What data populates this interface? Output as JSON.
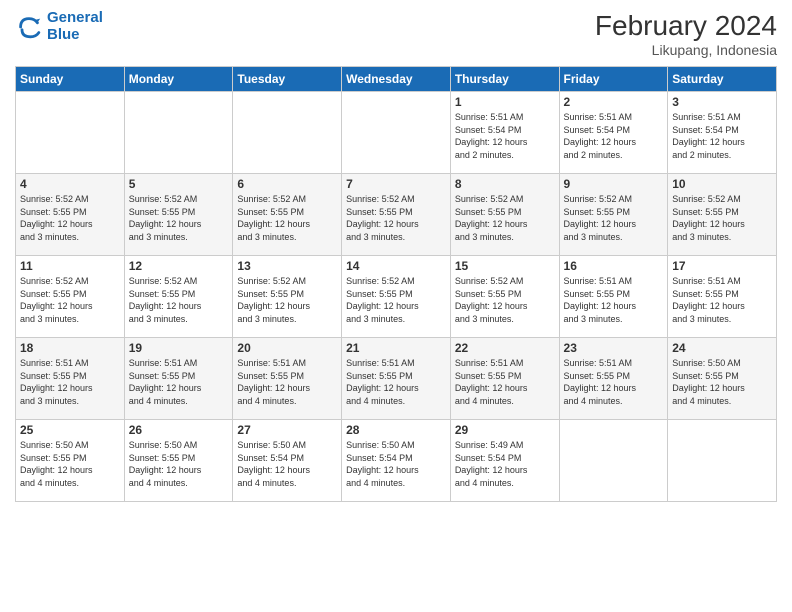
{
  "logo": {
    "line1": "General",
    "line2": "Blue"
  },
  "header": {
    "month": "February 2024",
    "location": "Likupang, Indonesia"
  },
  "weekdays": [
    "Sunday",
    "Monday",
    "Tuesday",
    "Wednesday",
    "Thursday",
    "Friday",
    "Saturday"
  ],
  "weeks": [
    [
      {
        "day": "",
        "info": ""
      },
      {
        "day": "",
        "info": ""
      },
      {
        "day": "",
        "info": ""
      },
      {
        "day": "",
        "info": ""
      },
      {
        "day": "1",
        "info": "Sunrise: 5:51 AM\nSunset: 5:54 PM\nDaylight: 12 hours\nand 2 minutes."
      },
      {
        "day": "2",
        "info": "Sunrise: 5:51 AM\nSunset: 5:54 PM\nDaylight: 12 hours\nand 2 minutes."
      },
      {
        "day": "3",
        "info": "Sunrise: 5:51 AM\nSunset: 5:54 PM\nDaylight: 12 hours\nand 2 minutes."
      }
    ],
    [
      {
        "day": "4",
        "info": "Sunrise: 5:52 AM\nSunset: 5:55 PM\nDaylight: 12 hours\nand 3 minutes."
      },
      {
        "day": "5",
        "info": "Sunrise: 5:52 AM\nSunset: 5:55 PM\nDaylight: 12 hours\nand 3 minutes."
      },
      {
        "day": "6",
        "info": "Sunrise: 5:52 AM\nSunset: 5:55 PM\nDaylight: 12 hours\nand 3 minutes."
      },
      {
        "day": "7",
        "info": "Sunrise: 5:52 AM\nSunset: 5:55 PM\nDaylight: 12 hours\nand 3 minutes."
      },
      {
        "day": "8",
        "info": "Sunrise: 5:52 AM\nSunset: 5:55 PM\nDaylight: 12 hours\nand 3 minutes."
      },
      {
        "day": "9",
        "info": "Sunrise: 5:52 AM\nSunset: 5:55 PM\nDaylight: 12 hours\nand 3 minutes."
      },
      {
        "day": "10",
        "info": "Sunrise: 5:52 AM\nSunset: 5:55 PM\nDaylight: 12 hours\nand 3 minutes."
      }
    ],
    [
      {
        "day": "11",
        "info": "Sunrise: 5:52 AM\nSunset: 5:55 PM\nDaylight: 12 hours\nand 3 minutes."
      },
      {
        "day": "12",
        "info": "Sunrise: 5:52 AM\nSunset: 5:55 PM\nDaylight: 12 hours\nand 3 minutes."
      },
      {
        "day": "13",
        "info": "Sunrise: 5:52 AM\nSunset: 5:55 PM\nDaylight: 12 hours\nand 3 minutes."
      },
      {
        "day": "14",
        "info": "Sunrise: 5:52 AM\nSunset: 5:55 PM\nDaylight: 12 hours\nand 3 minutes."
      },
      {
        "day": "15",
        "info": "Sunrise: 5:52 AM\nSunset: 5:55 PM\nDaylight: 12 hours\nand 3 minutes."
      },
      {
        "day": "16",
        "info": "Sunrise: 5:51 AM\nSunset: 5:55 PM\nDaylight: 12 hours\nand 3 minutes."
      },
      {
        "day": "17",
        "info": "Sunrise: 5:51 AM\nSunset: 5:55 PM\nDaylight: 12 hours\nand 3 minutes."
      }
    ],
    [
      {
        "day": "18",
        "info": "Sunrise: 5:51 AM\nSunset: 5:55 PM\nDaylight: 12 hours\nand 3 minutes."
      },
      {
        "day": "19",
        "info": "Sunrise: 5:51 AM\nSunset: 5:55 PM\nDaylight: 12 hours\nand 4 minutes."
      },
      {
        "day": "20",
        "info": "Sunrise: 5:51 AM\nSunset: 5:55 PM\nDaylight: 12 hours\nand 4 minutes."
      },
      {
        "day": "21",
        "info": "Sunrise: 5:51 AM\nSunset: 5:55 PM\nDaylight: 12 hours\nand 4 minutes."
      },
      {
        "day": "22",
        "info": "Sunrise: 5:51 AM\nSunset: 5:55 PM\nDaylight: 12 hours\nand 4 minutes."
      },
      {
        "day": "23",
        "info": "Sunrise: 5:51 AM\nSunset: 5:55 PM\nDaylight: 12 hours\nand 4 minutes."
      },
      {
        "day": "24",
        "info": "Sunrise: 5:50 AM\nSunset: 5:55 PM\nDaylight: 12 hours\nand 4 minutes."
      }
    ],
    [
      {
        "day": "25",
        "info": "Sunrise: 5:50 AM\nSunset: 5:55 PM\nDaylight: 12 hours\nand 4 minutes."
      },
      {
        "day": "26",
        "info": "Sunrise: 5:50 AM\nSunset: 5:55 PM\nDaylight: 12 hours\nand 4 minutes."
      },
      {
        "day": "27",
        "info": "Sunrise: 5:50 AM\nSunset: 5:54 PM\nDaylight: 12 hours\nand 4 minutes."
      },
      {
        "day": "28",
        "info": "Sunrise: 5:50 AM\nSunset: 5:54 PM\nDaylight: 12 hours\nand 4 minutes."
      },
      {
        "day": "29",
        "info": "Sunrise: 5:49 AM\nSunset: 5:54 PM\nDaylight: 12 hours\nand 4 minutes."
      },
      {
        "day": "",
        "info": ""
      },
      {
        "day": "",
        "info": ""
      }
    ]
  ]
}
